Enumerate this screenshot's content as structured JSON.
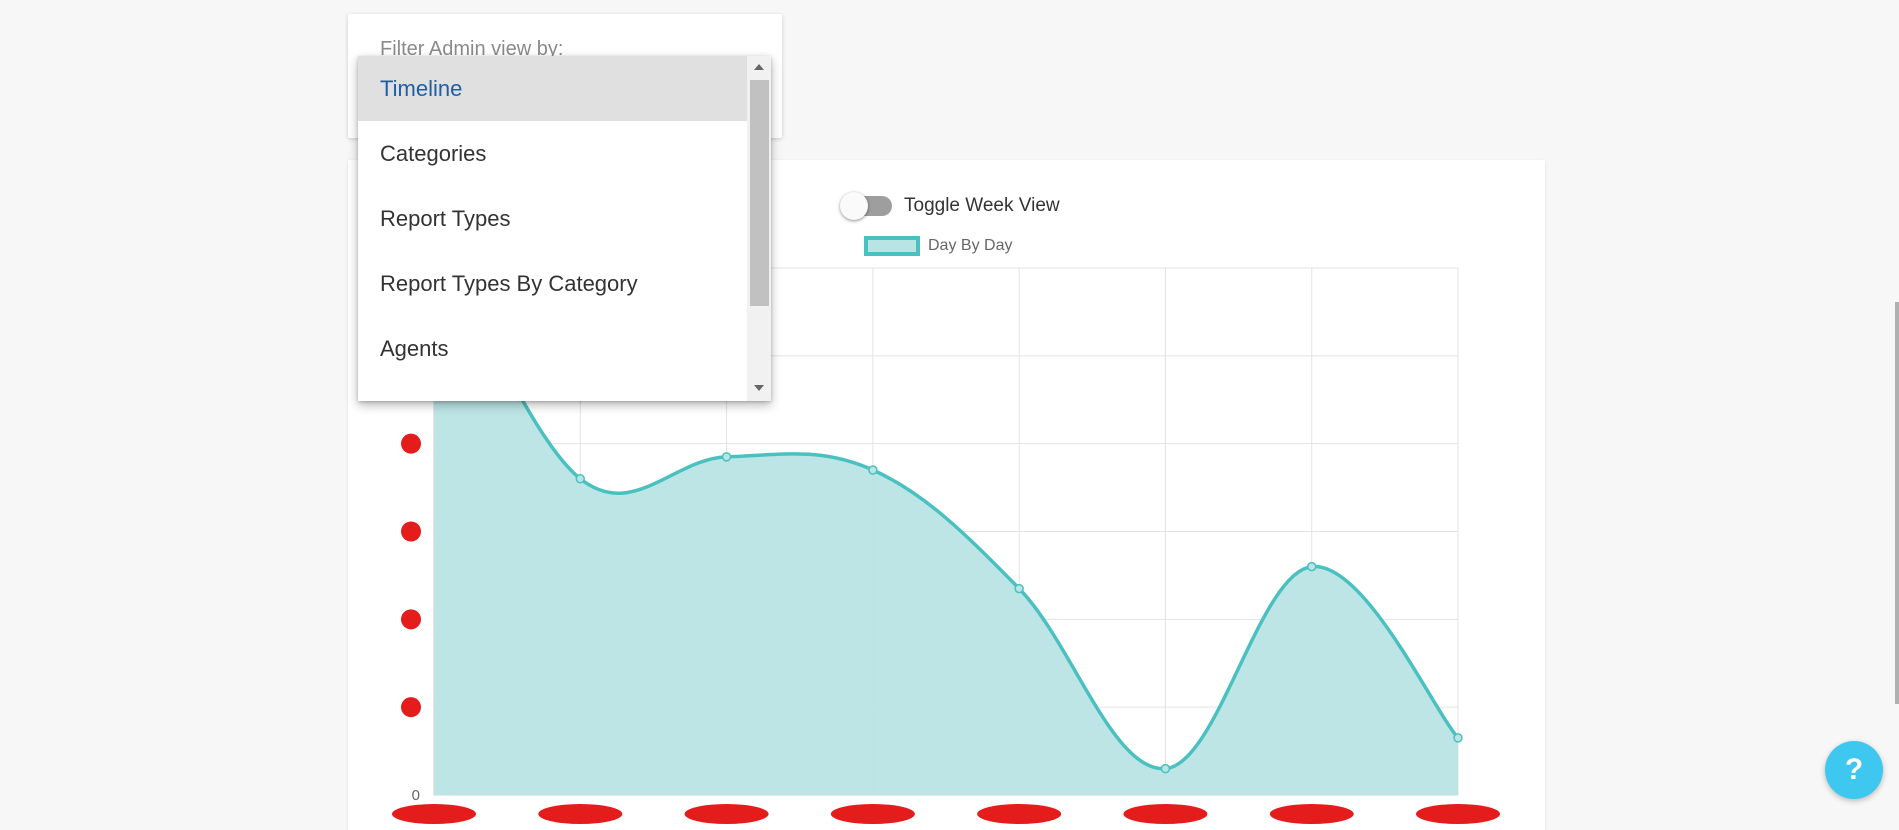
{
  "filter": {
    "label": "Filter Admin view by:",
    "options": [
      "Timeline",
      "Categories",
      "Report Types",
      "Report Types By Category",
      "Agents"
    ],
    "selected": "Timeline"
  },
  "toggle": {
    "label": "Toggle Week View",
    "on": false
  },
  "help": {
    "label": "?"
  },
  "chart_data": {
    "type": "area",
    "series": [
      {
        "name": "Day By Day",
        "values": [
          6.5,
          3.6,
          3.85,
          3.7,
          2.35,
          0.3,
          2.6,
          0.65
        ],
        "color": "#4bc0c0",
        "fill": "#b9e4e4"
      }
    ],
    "categories": [
      "",
      "",
      "",
      "",
      "",
      "",
      "",
      ""
    ],
    "ylim": [
      0,
      6
    ],
    "yticks": [
      "0",
      "",
      "",
      "",
      "",
      "",
      ""
    ],
    "grid": true,
    "legend": "top"
  }
}
